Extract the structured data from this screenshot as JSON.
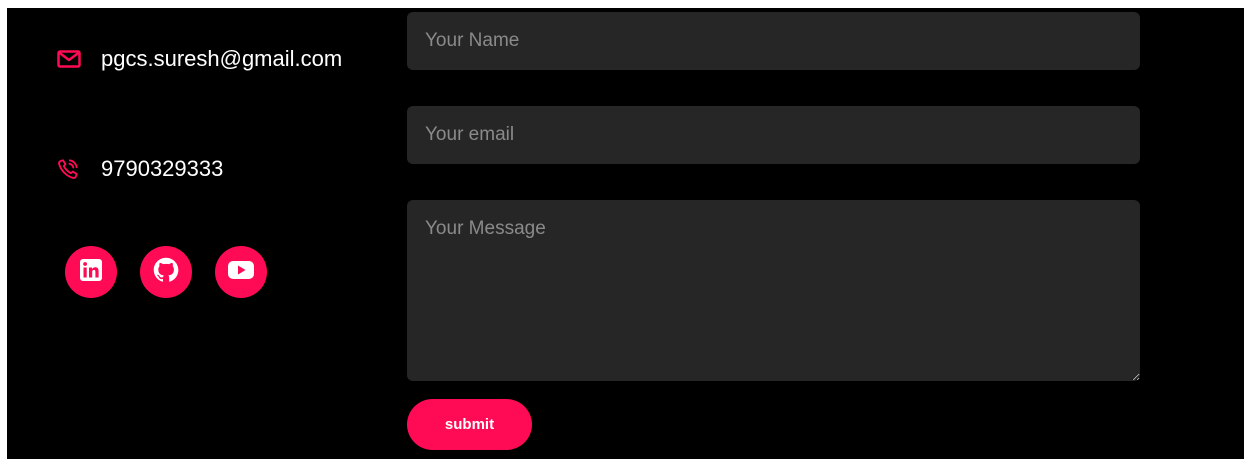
{
  "contact": {
    "email": "pgcs.suresh@gmail.com",
    "phone": "9790329333"
  },
  "social": [
    {
      "icon": "linkedin-icon"
    },
    {
      "icon": "github-icon"
    },
    {
      "icon": "youtube-icon"
    }
  ],
  "form": {
    "name_placeholder": "Your Name",
    "email_placeholder": "Your email",
    "message_placeholder": "Your Message",
    "submit_label": "submit"
  },
  "colors": {
    "accent": "#ff0a54",
    "background": "#000000",
    "field_background": "#262626",
    "placeholder": "#8a8a8a",
    "text": "#ffffff"
  }
}
